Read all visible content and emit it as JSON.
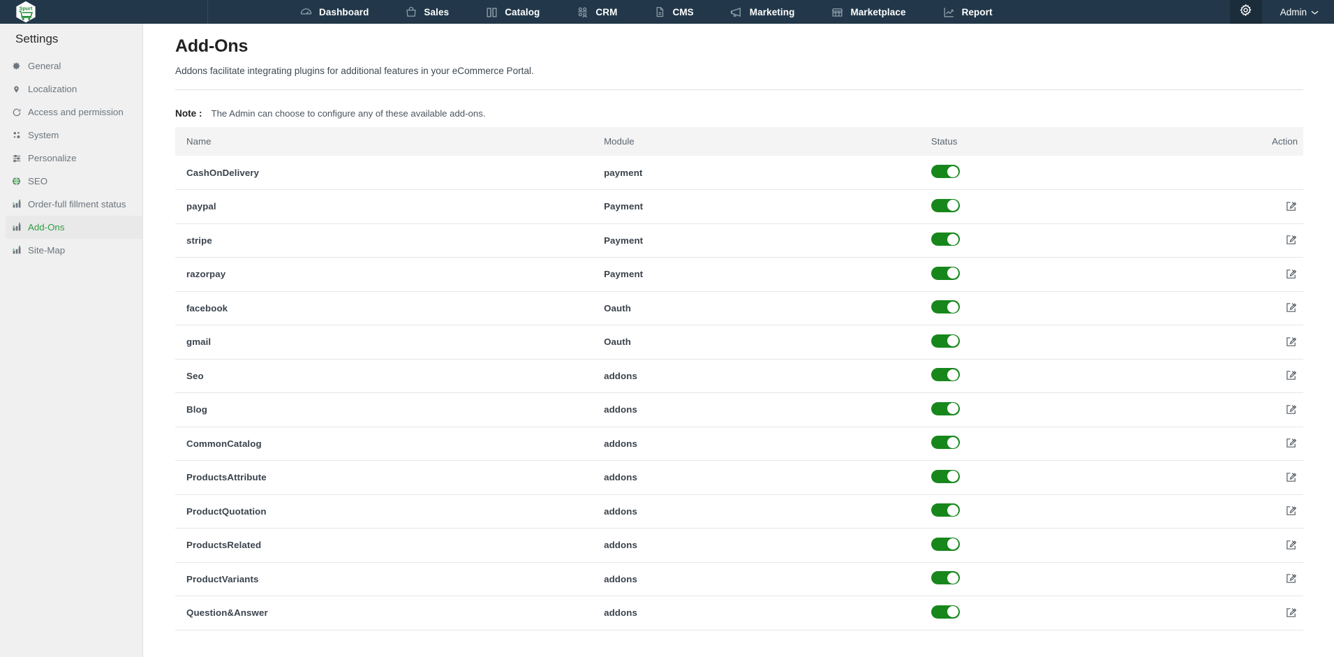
{
  "brand": {
    "logo_text": "Spurt",
    "logo_icon": "shopping-cart-hexagon-logo"
  },
  "topnav": {
    "items": [
      {
        "label": "Dashboard",
        "icon": "speedometer-icon"
      },
      {
        "label": "Sales",
        "icon": "shopping-bag-icon"
      },
      {
        "label": "Catalog",
        "icon": "book-open-icon"
      },
      {
        "label": "CRM",
        "icon": "users-icon"
      },
      {
        "label": "CMS",
        "icon": "document-icon"
      },
      {
        "label": "Marketing",
        "icon": "megaphone-icon"
      },
      {
        "label": "Marketplace",
        "icon": "storefront-icon"
      },
      {
        "label": "Report",
        "icon": "trending-up-icon"
      }
    ],
    "settings_icon": "gear-icon",
    "account_label": "Admin",
    "account_caret_icon": "chevron-down-icon"
  },
  "sidebar": {
    "title": "Settings",
    "items": [
      {
        "label": "General",
        "icon": "gear-icon",
        "active": false
      },
      {
        "label": "Localization",
        "icon": "map-pin-icon",
        "active": false
      },
      {
        "label": "Access and permission",
        "icon": "key-circle-icon",
        "active": false
      },
      {
        "label": "System",
        "icon": "cogs-icon",
        "active": false
      },
      {
        "label": "Personalize",
        "icon": "sliders-icon",
        "active": false
      },
      {
        "label": "SEO",
        "icon": "globe-icon",
        "active": false
      },
      {
        "label": "Order-full fillment status",
        "icon": "bar-chart-icon",
        "active": false
      },
      {
        "label": "Add-Ons",
        "icon": "bar-chart-icon",
        "active": true
      },
      {
        "label": "Site-Map",
        "icon": "bar-chart-icon",
        "active": false
      }
    ]
  },
  "main": {
    "title": "Add-Ons",
    "subtitle": "Addons facilitate integrating plugins for additional features in your eCommerce Portal.",
    "note_label": "Note :",
    "note_text": "The Admin can choose to configure any of these available add-ons.",
    "table": {
      "columns": [
        "Name",
        "Module",
        "Status",
        "Action"
      ],
      "rows": [
        {
          "name": "CashOnDelivery",
          "module": "payment",
          "status_on": true,
          "has_edit": false
        },
        {
          "name": "paypal",
          "module": "Payment",
          "status_on": true,
          "has_edit": true
        },
        {
          "name": "stripe",
          "module": "Payment",
          "status_on": true,
          "has_edit": true
        },
        {
          "name": "razorpay",
          "module": "Payment",
          "status_on": true,
          "has_edit": true
        },
        {
          "name": "facebook",
          "module": "Oauth",
          "status_on": true,
          "has_edit": true
        },
        {
          "name": "gmail",
          "module": "Oauth",
          "status_on": true,
          "has_edit": true
        },
        {
          "name": "Seo",
          "module": "addons",
          "status_on": true,
          "has_edit": true
        },
        {
          "name": "Blog",
          "module": "addons",
          "status_on": true,
          "has_edit": true
        },
        {
          "name": "CommonCatalog",
          "module": "addons",
          "status_on": true,
          "has_edit": true
        },
        {
          "name": "ProductsAttribute",
          "module": "addons",
          "status_on": true,
          "has_edit": true
        },
        {
          "name": "ProductQuotation",
          "module": "addons",
          "status_on": true,
          "has_edit": true
        },
        {
          "name": "ProductsRelated",
          "module": "addons",
          "status_on": true,
          "has_edit": true
        },
        {
          "name": "ProductVariants",
          "module": "addons",
          "status_on": true,
          "has_edit": true
        },
        {
          "name": "Question&Answer",
          "module": "addons",
          "status_on": true,
          "has_edit": true
        }
      ],
      "edit_icon": "edit-pencil-icon",
      "toggle_icon": "status-toggle"
    }
  },
  "colors": {
    "topbar_bg": "#22384a",
    "accent_green": "#2f9e41",
    "toggle_green": "#17871c",
    "sidebar_bg": "#f0f0f0",
    "table_head_bg": "#f4f4f4"
  }
}
